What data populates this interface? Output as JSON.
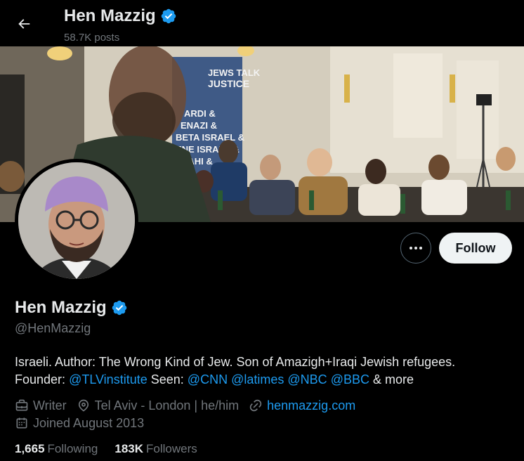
{
  "header": {
    "name": "Hen Mazzig",
    "posts": "58.7K posts"
  },
  "banner": {
    "sign_line1": "JEWS TALK",
    "sign_line2": "JUSTICE",
    "sign_list": [
      "ARDI &",
      "ENAZI &",
      "BETA ISRAEL &",
      "ENE ISRAEL &",
      "RAHI &"
    ]
  },
  "actions": {
    "more_icon": "more-horizontal-icon",
    "follow_label": "Follow"
  },
  "profile": {
    "name": "Hen Mazzig",
    "handle": "@HenMazzig",
    "bio_line1": "Israeli. Author: The Wrong Kind of Jew. Son of Amazigh+Iraqi Jewish refugees.",
    "bio_founder": "Founder:",
    "bio_tlv": "@TLVinstitute",
    "bio_seen": "Seen:",
    "bio_cnn": "@CNN",
    "bio_latimes": "@latimes",
    "bio_nbc": "@NBC",
    "bio_bbc": "@BBC",
    "bio_more": "& more",
    "occupation": "Writer",
    "location": "Tel Aviv - London | he/him",
    "website": "henmazzig.com",
    "joined": "Joined August 2013"
  },
  "stats": {
    "following_count": "1,665",
    "following_label": "Following",
    "followers_count": "183K",
    "followers_label": "Followers"
  },
  "colors": {
    "accent": "#1d9bf0",
    "verified": "#1d9bf0",
    "muted": "#71767b"
  }
}
